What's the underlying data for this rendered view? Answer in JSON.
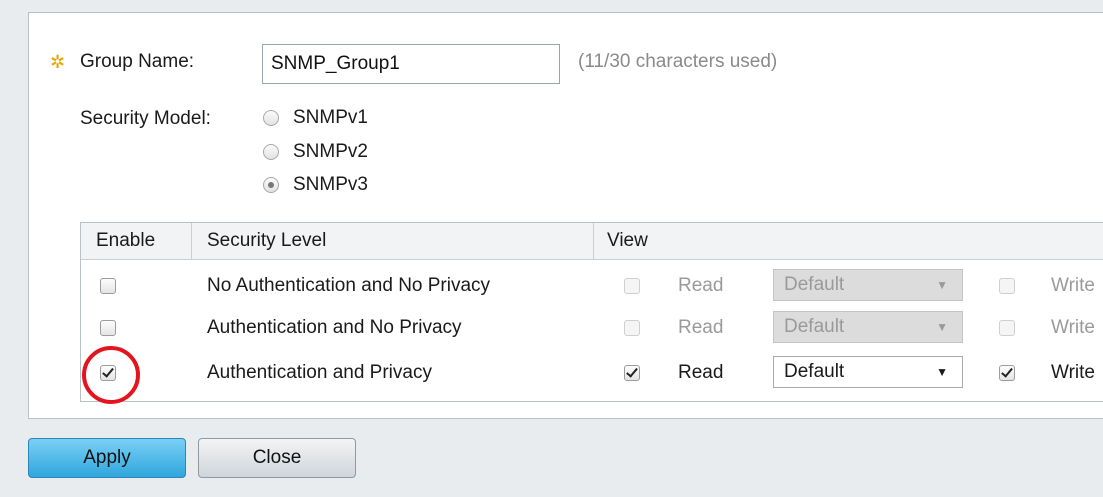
{
  "form": {
    "group_name_label": "Group Name:",
    "group_name_value": "SNMP_Group1",
    "char_count_note": "(11/30 characters used)",
    "security_model_label": "Security Model:",
    "security_models": [
      {
        "label": "SNMPv1",
        "selected": false
      },
      {
        "label": "SNMPv2",
        "selected": false
      },
      {
        "label": "SNMPv3",
        "selected": true
      }
    ]
  },
  "table": {
    "headers": {
      "enable": "Enable",
      "security_level": "Security Level",
      "view": "View"
    },
    "rows": [
      {
        "enabled": false,
        "level": "No Authentication and No Privacy",
        "read_label": "Read",
        "read_view": "Default",
        "write_label": "Write",
        "disabled": true
      },
      {
        "enabled": false,
        "level": "Authentication and No Privacy",
        "read_label": "Read",
        "read_view": "Default",
        "write_label": "Write",
        "disabled": true
      },
      {
        "enabled": true,
        "level": "Authentication and Privacy",
        "read_label": "Read",
        "read_view": "Default",
        "write_label": "Write",
        "disabled": false
      }
    ]
  },
  "buttons": {
    "apply": "Apply",
    "close": "Close"
  },
  "colors": {
    "highlight": "#e5131d",
    "apply_button": "#2fa6dd",
    "required_icon": "#e8a400"
  }
}
